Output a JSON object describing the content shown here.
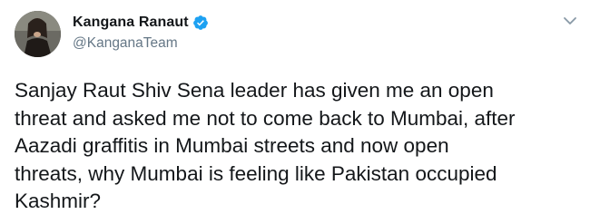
{
  "tweet": {
    "author": {
      "display_name": "Kangana Ranaut",
      "handle": "@KanganaTeam",
      "verified": true
    },
    "text": "Sanjay Raut Shiv Sena leader has given me an open\nthreat and asked me not to come back to Mumbai, after\nAazadi graffitis in Mumbai streets and now open\nthreats, why Mumbai is feeling like Pakistan occupied\nKashmir?",
    "colors": {
      "name": "#14171a",
      "handle": "#657786",
      "verified_badge": "#1da1f2",
      "caret": "#657786"
    },
    "icons": {
      "verified": "verified-badge-icon",
      "menu": "chevron-down-icon"
    }
  }
}
